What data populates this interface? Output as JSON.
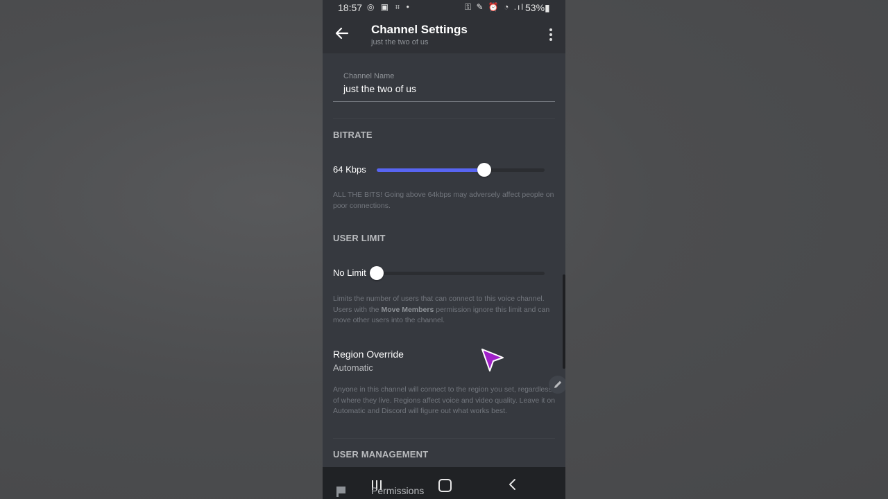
{
  "status_bar": {
    "time": "18:57",
    "left_icons": "◎ ▣ ⌗ •",
    "right_icons": "⚿ ✎ ⏰ ◔ .ıl",
    "battery": "53%▮"
  },
  "header": {
    "title": "Channel Settings",
    "subtitle": "just the two of us"
  },
  "channel_name": {
    "label": "Channel Name",
    "value": "just the two of us"
  },
  "bitrate": {
    "header": "BITRATE",
    "value_label": "64 Kbps",
    "level": 0.64,
    "help": "ALL THE BITS! Going above 64kbps may adversely affect people on poor connections."
  },
  "user_limit": {
    "header": "USER LIMIT",
    "value_label": "No Limit",
    "level": 0,
    "help_part1": "Limits the number of users that can connect to this voice channel. Users with the ",
    "help_bold": "Move Members",
    "help_part2": " permission ignore this limit and can move other users into the channel."
  },
  "region": {
    "title": "Region Override",
    "value": "Automatic",
    "help": "Anyone in this channel will connect to the region you set, regardless of where they live. Regions affect voice and video quality. Leave it on Automatic and Discord will figure out what works best."
  },
  "user_management": {
    "header": "USER MANAGEMENT"
  },
  "bottom_nav": {
    "permissions_label": "Permissions"
  },
  "colors": {
    "accent": "#5865f2",
    "background": "#36393f",
    "cursor": "#a020c8"
  },
  "icons": [
    "back-arrow-icon",
    "more-vertical-icon",
    "pencil-icon",
    "flag-icon",
    "recents-icon",
    "home-icon",
    "nav-back-icon",
    "cursor-pointer-icon"
  ]
}
